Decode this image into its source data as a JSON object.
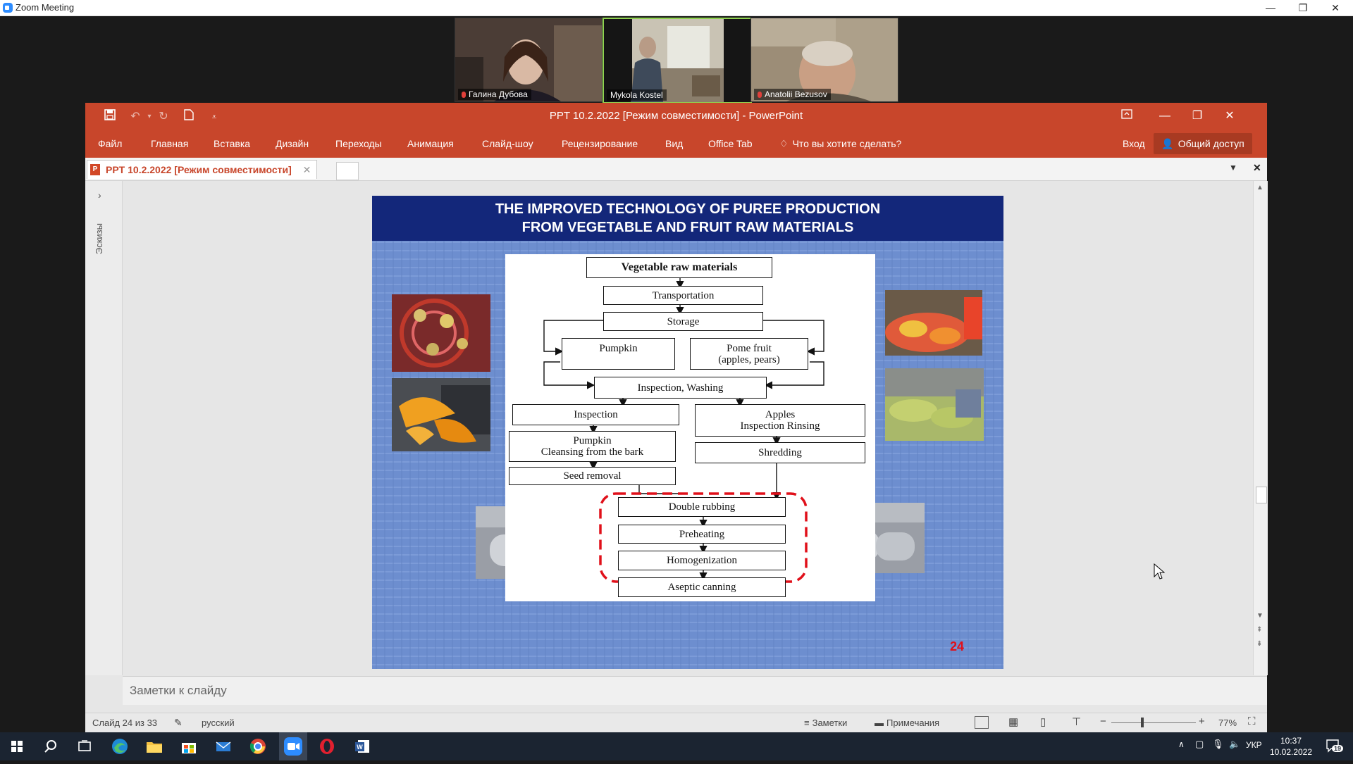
{
  "zoom": {
    "window_title": "Zoom Meeting",
    "participants": [
      {
        "name": "Галина Дубова"
      },
      {
        "name": "Mykola Kostel"
      },
      {
        "name": "Anatolii Bezusov"
      }
    ]
  },
  "ppt": {
    "window_title": "PPT 10.2.2022 [Режим совместимости] - PowerPoint",
    "menu": [
      "Файл",
      "Главная",
      "Вставка",
      "Дизайн",
      "Переходы",
      "Анимация",
      "Слайд-шоу",
      "Рецензирование",
      "Вид",
      "Office Tab"
    ],
    "tell_me": "Что вы хотите сделать?",
    "sign_in": "Вход",
    "share": "Общий доступ",
    "doc_tab": "PPT 10.2.2022 [Режим совместимости]",
    "thumbnails_label": "Эскизы",
    "notes_placeholder": "Заметки к слайду",
    "status": {
      "slide_counter": "Слайд 24 из 33",
      "language": "русский",
      "notes_btn": "Заметки",
      "comments_btn": "Примечания",
      "zoom": "77%"
    }
  },
  "slide": {
    "title_line1": "THE IMPROVED TECHNOLOGY OF PUREE PRODUCTION",
    "title_line2": "FROM VEGETABLE AND FRUIT RAW MATERIALS",
    "number": "24",
    "flow": {
      "raw": "Vegetable raw materials",
      "transport": "Transportation",
      "storage": "Storage",
      "pumpkin": "Pumpkin",
      "pome1": "Pome fruit",
      "pome2": "(apples, pears)",
      "washing": "Inspection, Washing",
      "inspection": "Inspection",
      "apples1": "Apples",
      "apples2": "Inspection Rinsing",
      "cleansing1": "Pumpkin",
      "cleansing2": "Cleansing from the bark",
      "shredding": "Shredding",
      "seed": "Seed removal",
      "double": "Double rubbing",
      "preheat": "Preheating",
      "homog": "Homogenization",
      "aseptic": "Aseptic canning"
    }
  },
  "taskbar": {
    "lang": "УКР",
    "time": "10:37",
    "date": "10.02.2022",
    "notifications": "19"
  }
}
